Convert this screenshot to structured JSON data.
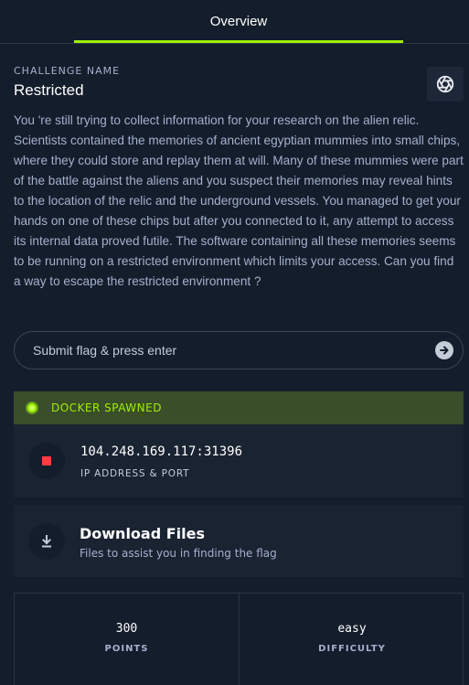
{
  "tabs": [
    {
      "label": "Overview",
      "active": true
    }
  ],
  "challenge": {
    "section_label": "CHALLENGE NAME",
    "name": "Restricted",
    "description": "You 're still trying to collect information for your research on the alien relic. Scientists contained the memories of ancient egyptian mummies into small chips, where they could store and replay them at will. Many of these mummies were part of the battle against the aliens and you suspect their memories may reveal hints to the location of the relic and the underground vessels. You managed to get your hands on one of these chips but after you connected to it, any attempt to access its internal data proved futile. The software containing all these memories seems to be running on a restricted environment which limits your access. Can you find a way to escape the restricted environment ?"
  },
  "flag_input": {
    "placeholder": "Submit flag & press enter",
    "value": ""
  },
  "docker": {
    "status": "DOCKER SPAWNED",
    "address": "104.248.169.117:31396",
    "address_label": "IP ADDRESS & PORT"
  },
  "download": {
    "title": "Download Files",
    "subtitle": "Files to assist you in finding the flag"
  },
  "stats": {
    "points": {
      "value": "300",
      "label": "POINTS"
    },
    "difficulty": {
      "value": "easy",
      "label": "DIFFICULTY"
    }
  },
  "icons": {
    "share": "aperture-icon",
    "submit": "arrow-right-icon",
    "stop": "stop-icon",
    "download": "download-icon",
    "status": "status-dot-icon"
  },
  "colors": {
    "accent": "#9fef00",
    "background": "#141d2b",
    "card": "#1a2332",
    "stop": "#ff3e3e"
  }
}
